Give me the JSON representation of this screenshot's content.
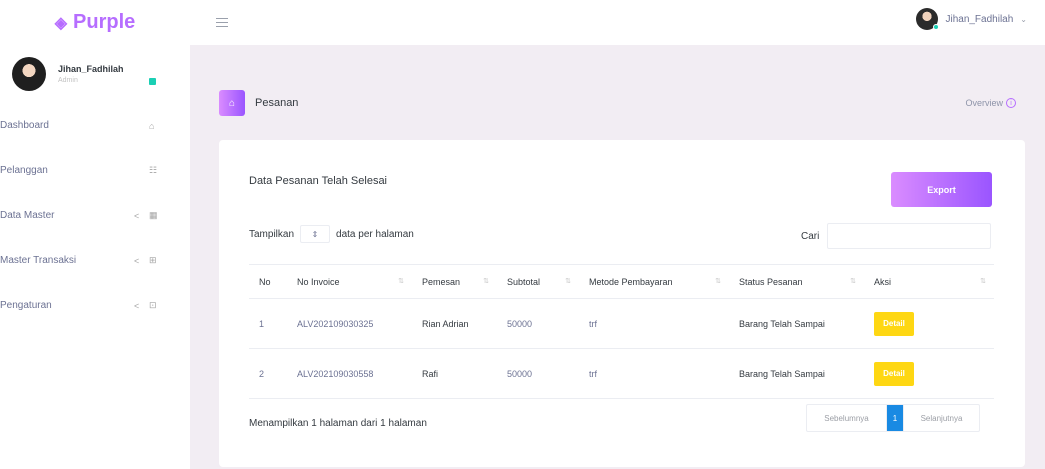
{
  "brand": {
    "name": "Purple",
    "logo_icon": "brand-logo-icon"
  },
  "navbar": {
    "user_name": "Jihan_Fadhilah",
    "caret": "⌄"
  },
  "sidebar": {
    "profile": {
      "name": "Jihan_Fadhilah",
      "role": "Admin"
    },
    "items": [
      {
        "label": "Dashboard",
        "icon": "home-icon"
      },
      {
        "label": "Pelanggan",
        "icon": "users-icon"
      },
      {
        "label": "Data Master",
        "icon": "table-icon",
        "chevron": "<"
      },
      {
        "label": "Master Transaksi",
        "icon": "bag-icon",
        "chevron": "<"
      },
      {
        "label": "Pengaturan",
        "icon": "lock-icon",
        "chevron": "<"
      }
    ]
  },
  "page_header": {
    "title": "Pesanan",
    "overview": "Overview"
  },
  "card": {
    "title": "Data Pesanan Telah Selesai",
    "export_label": "Export",
    "length": {
      "prefix": "Tampilkan",
      "suffix": "data per halaman"
    },
    "search_label": "Cari",
    "search_placeholder": "",
    "columns": [
      "No",
      "No Invoice",
      "Pemesan",
      "Subtotal",
      "Metode Pembayaran",
      "Status Pesanan",
      "Aksi"
    ],
    "rows": [
      {
        "no": "1",
        "invoice": "ALV202109030325",
        "pemesan": "Rian Adrian",
        "subtotal": "50000",
        "metode": "trf",
        "status": "Barang Telah Sampai",
        "aksi": "Detail"
      },
      {
        "no": "2",
        "invoice": "ALV202109030558",
        "pemesan": "Rafi",
        "subtotal": "50000",
        "metode": "trf",
        "status": "Barang Telah Sampai",
        "aksi": "Detail"
      }
    ],
    "info": "Menampilkan 1 halaman dari 1 halaman",
    "pagination": {
      "prev": "Sebelumnya",
      "current": "1",
      "next": "Selanjutnya"
    }
  },
  "colors": {
    "accent": "#b66dff",
    "gradient_start": "#da8cff",
    "gradient_end": "#9a55ff",
    "detail_btn": "#fed713",
    "page_active": "#198ae3",
    "online": "#1bcfb4"
  }
}
